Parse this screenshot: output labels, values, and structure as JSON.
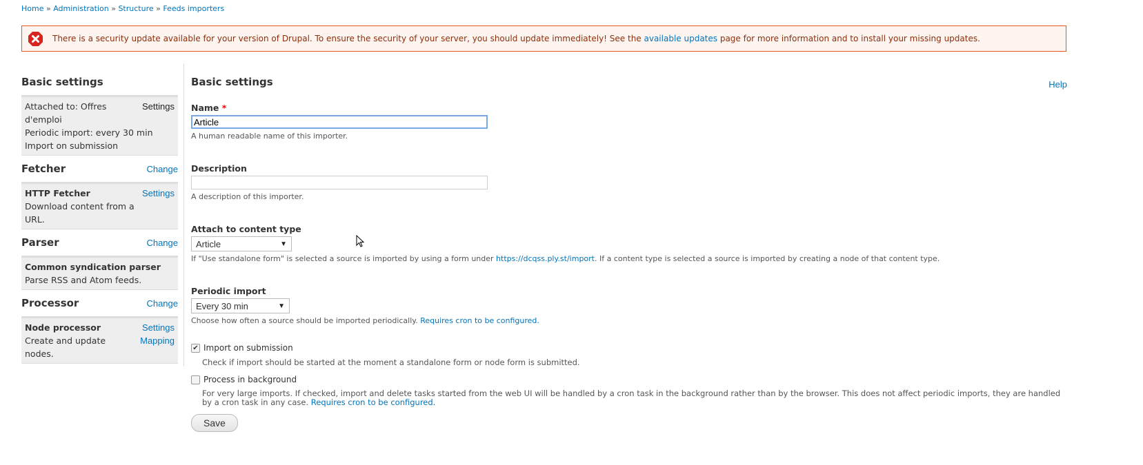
{
  "breadcrumb": [
    {
      "label": "Home"
    },
    {
      "label": "Administration"
    },
    {
      "label": "Structure"
    },
    {
      "label": "Feeds importers"
    }
  ],
  "breadcrumb_separator": "»",
  "message": {
    "type": "error",
    "icon": "error-icon",
    "text_before": "There is a security update available for your version of Drupal. To ensure the security of your server, you should update immediately! See the ",
    "link": "available updates",
    "text_after": " page for more information and to install your missing updates."
  },
  "sidebar": {
    "sections": [
      {
        "title": "Basic settings",
        "header_link": "",
        "box_title": "",
        "box_lines": [
          "Attached to: Offres d'emploi",
          "Periodic import: every 30 min",
          "Import on submission"
        ],
        "actions": [
          "Settings"
        ]
      },
      {
        "title": "Fetcher",
        "header_link": "Change",
        "box_title": "HTTP Fetcher",
        "box_lines": [
          "Download content from a URL."
        ],
        "actions": [
          "Settings"
        ]
      },
      {
        "title": "Parser",
        "header_link": "Change",
        "box_title": "Common syndication parser",
        "box_lines": [
          "Parse RSS and Atom feeds."
        ],
        "actions": []
      },
      {
        "title": "Processor",
        "header_link": "Change",
        "box_title": "Node processor",
        "box_lines": [
          "Create and update nodes."
        ],
        "actions": [
          "Settings",
          "Mapping"
        ]
      }
    ]
  },
  "main": {
    "title": "Basic settings",
    "help": "Help",
    "name": {
      "label": "Name",
      "required": "*",
      "value": "Article",
      "description": "A human readable name of this importer."
    },
    "description": {
      "label": "Description",
      "value": "",
      "description": "A description of this importer."
    },
    "content_type": {
      "label": "Attach to content type",
      "selected": "Article",
      "desc_before": "If \"Use standalone form\" is selected a source is imported by using a form under ",
      "desc_link": "https://dcqss.ply.st/import",
      "desc_after": ". If a content type is selected a source is imported by creating a node of that content type."
    },
    "periodic": {
      "label": "Periodic import",
      "selected": "Every 30 min",
      "desc_before": "Choose how often a source should be imported periodically. ",
      "desc_link": "Requires cron to be configured."
    },
    "import_on_submission": {
      "label": "Import on submission",
      "checked": true,
      "description": "Check if import should be started at the moment a standalone form or node form is submitted."
    },
    "process_in_background": {
      "label": "Process in background",
      "checked": false,
      "desc_before": "For very large imports. If checked, import and delete tasks started from the web UI will be handled by a cron task in the background rather than by the browser. This does not affect periodic imports, they are handled by a cron task in any case. ",
      "desc_link": "Requires cron to be configured."
    },
    "save": "Save"
  },
  "colors": {
    "link": "#0074bd",
    "error_border": "#ed541d",
    "error_bg": "#fef5f1",
    "error_text": "#8c2e0b"
  }
}
